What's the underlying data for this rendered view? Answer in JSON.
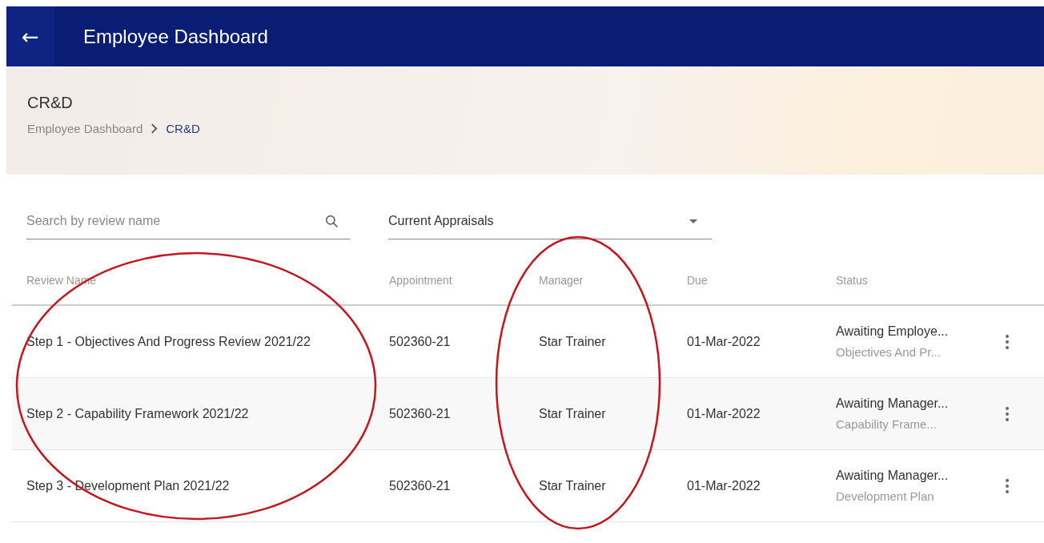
{
  "app_bar": {
    "back_icon": "←",
    "title": "Employee Dashboard"
  },
  "page_header": {
    "title": "CR&D",
    "breadcrumb": [
      {
        "label": "Employee Dashboard",
        "current": false
      },
      {
        "label": "CR&D",
        "current": true
      }
    ]
  },
  "filters": {
    "search": {
      "placeholder": "Search by review name"
    },
    "appraisal_select": {
      "value": "Current Appraisals"
    }
  },
  "table": {
    "columns": [
      "Review Name",
      "Appointment",
      "Manager",
      "Due",
      "Status"
    ],
    "rows": [
      {
        "review_name": "Step 1 - Objectives And Progress Review 2021/22",
        "appointment": "502360-21",
        "manager": "Star Trainer",
        "due": "01-Mar-2022",
        "status": "Awaiting Employe...",
        "status_detail": "Objectives And Pr..."
      },
      {
        "review_name": "Step 2 - Capability Framework 2021/22",
        "appointment": "502360-21",
        "manager": "Star Trainer",
        "due": "01-Mar-2022",
        "status": "Awaiting Manager...",
        "status_detail": "Capability Frame..."
      },
      {
        "review_name": "Step 3 - Development Plan 2021/22",
        "appointment": "502360-21",
        "manager": "Star Trainer",
        "due": "01-Mar-2022",
        "status": "Awaiting Manager...",
        "status_detail": "Development Plan"
      }
    ]
  },
  "annotations": [
    {
      "kind": "ellipse",
      "color": "#c4161c"
    },
    {
      "kind": "ellipse",
      "color": "#c4161c"
    }
  ]
}
